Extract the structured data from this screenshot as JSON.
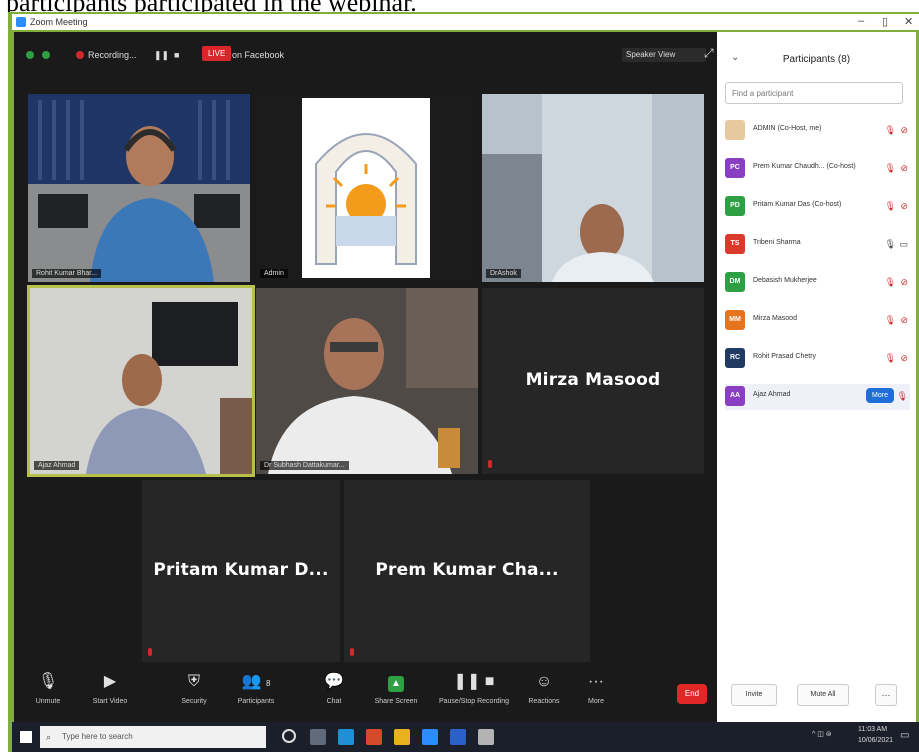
{
  "caption": "participants participated in the webinar.",
  "window": {
    "title": "Zoom Meeting",
    "controls": [
      "–",
      "▯",
      "✕"
    ]
  },
  "topbar": {
    "recording_label": "Recording...",
    "live_label": "LIVE",
    "live_on": "on Facebook",
    "view_label": "Speaker View"
  },
  "tiles": [
    {
      "name": "Rohit Kumar Bhar..."
    },
    {
      "name": "Admin"
    },
    {
      "name": "DrAshok"
    },
    {
      "name": "Ajaz Ahmad"
    },
    {
      "name": "Dr Subhash Dattakumar..."
    },
    {
      "name": "Mirza Masood"
    },
    {
      "name": "Pritam Kumar D..."
    },
    {
      "name": "Prem Kumar Cha..."
    }
  ],
  "toolbar": {
    "buttons": [
      {
        "label": "Unmute",
        "icon": "microphone-icon"
      },
      {
        "label": "Start Video",
        "icon": "video-icon"
      },
      {
        "label": "Security",
        "icon": "shield-icon"
      },
      {
        "label": "Participants",
        "icon": "people-icon",
        "count": "8"
      },
      {
        "label": "Chat",
        "icon": "chat-icon"
      },
      {
        "label": "Share Screen",
        "icon": "share-screen-icon"
      },
      {
        "label": "Pause/Stop Recording",
        "icon": "record-icon"
      },
      {
        "label": "Reactions",
        "icon": "reaction-icon"
      },
      {
        "label": "More",
        "icon": "more-icon"
      }
    ],
    "end_label": "End"
  },
  "participants_panel": {
    "title": "Participants (8)",
    "search_placeholder": "Find a participant",
    "participants": [
      {
        "name": "ADMIN (Co-Host, me)",
        "initials": "",
        "color": "#e7c9a0"
      },
      {
        "name": "Prem Kumar Chaudh... (Co-host)",
        "initials": "PC",
        "color": "#8a3fc2"
      },
      {
        "name": "Pritam Kumar Das (Co-host)",
        "initials": "PD",
        "color": "#2ea043"
      },
      {
        "name": "Tribeni Sharma",
        "initials": "TS",
        "color": "#d93a2b"
      },
      {
        "name": "Debasish Mukherjee",
        "initials": "DM",
        "color": "#2ea043"
      },
      {
        "name": "Mirza Masood",
        "initials": "MM",
        "color": "#e6731e"
      },
      {
        "name": "Rohit Prasad Chetry",
        "initials": "RC",
        "color": "#1f3b63"
      },
      {
        "name": "Ajaz Ahmad",
        "initials": "AA",
        "color": "#8a3fc2"
      }
    ],
    "more_label": "More",
    "invite_label": "Invite",
    "mute_all_label": "Mute All"
  },
  "taskbar": {
    "search_placeholder": "Type here to search",
    "time": "11:03 AM",
    "date": "10/06/2021"
  },
  "colors": {
    "frame_green": "#7fae3a",
    "end_red": "#e02828",
    "active_outline": "#b6c04a",
    "accent_blue": "#1f6fd6"
  }
}
